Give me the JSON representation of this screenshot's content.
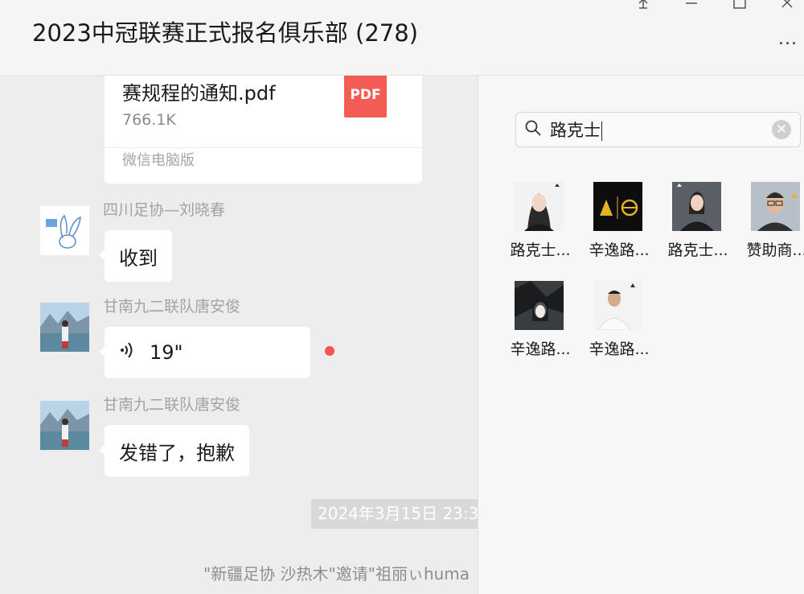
{
  "window": {
    "title": "2023中冠联赛正式报名俱乐部 (278)",
    "more_label": "..."
  },
  "chat": {
    "file_message": {
      "file_name": "赛规程的通知.pdf",
      "file_size": "766.1K",
      "file_type": "PDF",
      "source": "微信电脑版"
    },
    "messages": [
      {
        "sender": "四川足协—刘晓春",
        "text": "收到"
      },
      {
        "sender": "甘南九二联队唐安俊",
        "voice_duration": "19\"",
        "unread": true
      },
      {
        "sender": "甘南九二联队唐安俊",
        "text": "发错了，抱歉"
      }
    ],
    "timestamp": "2024年3月15日 23:3",
    "system_message": "\"新疆足协 沙热木\"邀请\"祖丽ぃhuma"
  },
  "member_panel": {
    "search_value": "路克士",
    "results": [
      {
        "name": "路克士...",
        "avatar": "woman-portrait"
      },
      {
        "name": "辛逸路...",
        "avatar": "looks-logo"
      },
      {
        "name": "路克士...",
        "avatar": "woman-suit"
      },
      {
        "name": "赞助商...",
        "avatar": "man-glasses"
      },
      {
        "name": "辛逸路...",
        "avatar": "wolf-girl"
      },
      {
        "name": "辛逸路...",
        "avatar": "man-white-shirt"
      }
    ]
  },
  "colors": {
    "background": "#ededed",
    "pdf_red": "#f25c54",
    "unread_red": "#f25353"
  }
}
